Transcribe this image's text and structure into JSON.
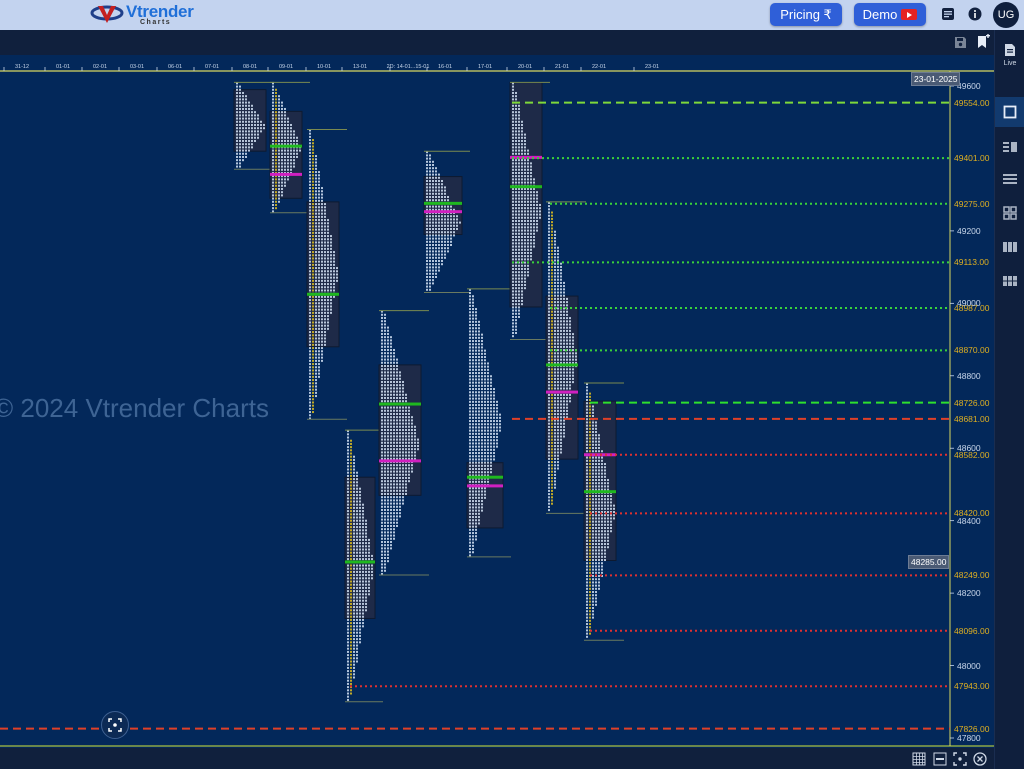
{
  "header": {
    "logo_text": "Vtrender",
    "logo_sub": "Charts",
    "pricing_label": "Pricing ₹",
    "demo_label": "Demo",
    "avatar_initials": "UG"
  },
  "right_sidebar": {
    "live_label": "Live",
    "items": [
      "single-chart",
      "split-chart",
      "rows-layout",
      "grid-layout",
      "columns-layout",
      "table-layout"
    ]
  },
  "watermark": "© 2024 Vtrender Charts",
  "chart": {
    "date_tooltip": "23-01-2025",
    "price_tooltip": "48285.00",
    "x_dates": [
      "31-12",
      "01-01",
      "02-01",
      "03-01",
      "06-01",
      "07-01",
      "08-01",
      "09-01",
      "10-01",
      "13-01",
      "2D: 14-01...15-01",
      "16-01",
      "17-01",
      "20-01",
      "21-01",
      "22-01",
      "23-01"
    ],
    "y_ticks": [
      "49600",
      "49200",
      "49000",
      "48800",
      "48600",
      "48400",
      "48200",
      "48000",
      "47800"
    ],
    "levels": [
      {
        "label": "49554.00",
        "value": 49554,
        "color": "#7fd83a",
        "style": "dashed"
      },
      {
        "label": "49401.00",
        "value": 49401,
        "color": "#39d23a",
        "style": "dotted"
      },
      {
        "label": "49275.00",
        "value": 49275,
        "color": "#39d23a",
        "style": "dotted"
      },
      {
        "label": "49113.00",
        "value": 49113,
        "color": "#39d23a",
        "style": "dotted"
      },
      {
        "label": "48987.00",
        "value": 48987,
        "color": "#39d23a",
        "style": "dotted"
      },
      {
        "label": "48870.00",
        "value": 48870,
        "color": "#39d23a",
        "style": "dotted"
      },
      {
        "label": "48726.00",
        "value": 48726,
        "color": "#2ee02e",
        "style": "dashed"
      },
      {
        "label": "48681.00",
        "value": 48681,
        "color": "#e04028",
        "style": "dashed"
      },
      {
        "label": "48582.00",
        "value": 48582,
        "color": "#e03030",
        "style": "dotted"
      },
      {
        "label": "48420.00",
        "value": 48420,
        "color": "#e03030",
        "style": "dotted"
      },
      {
        "label": "48249.00",
        "value": 48249,
        "color": "#e03030",
        "style": "dotted"
      },
      {
        "label": "48096.00",
        "value": 48096,
        "color": "#e03030",
        "style": "dotted"
      },
      {
        "label": "47943.00",
        "value": 47943,
        "color": "#e03030",
        "style": "dotted"
      },
      {
        "label": "47826.00",
        "value": 47826,
        "color": "#e04028",
        "style": "dashed"
      }
    ],
    "profiles": [
      {
        "date": "08-01",
        "high": 49610,
        "low": 49370,
        "vah": 49590,
        "val": 49420,
        "poc": null,
        "vpoc": null
      },
      {
        "date": "09-01",
        "high": 49610,
        "low": 49250,
        "vah": 49530,
        "val": 49290,
        "poc": 49434,
        "vpoc": 49356
      },
      {
        "date": "10-01",
        "high": 49480,
        "low": 48680,
        "vah": 49280,
        "val": 48880,
        "poc": 49025,
        "vpoc": null
      },
      {
        "date": "13-01",
        "high": 48650,
        "low": 47900,
        "vah": 48520,
        "val": 48130,
        "poc": 48286,
        "vpoc": null
      },
      {
        "date": "2D: 14-01...15-01",
        "high": 48980,
        "low": 48250,
        "vah": 48830,
        "val": 48470,
        "poc": 48722,
        "vpoc": 48565
      },
      {
        "date": "16-01",
        "high": 49420,
        "low": 49030,
        "vah": 49350,
        "val": 49190,
        "poc": 49276,
        "vpoc": 49253
      },
      {
        "date": "17-01",
        "high": 49040,
        "low": 48300,
        "vah": 48560,
        "val": 48380,
        "poc": 48520,
        "vpoc": 48496
      },
      {
        "date": "20-01",
        "high": 49610,
        "low": 48900,
        "vah": 49610,
        "val": 48990,
        "poc": 49322,
        "vpoc": 49403
      },
      {
        "date": "21-01",
        "high": 49280,
        "low": 48420,
        "vah": 49020,
        "val": 48570,
        "poc": 48830,
        "vpoc": 48755
      },
      {
        "date": "22-01",
        "high": 48780,
        "low": 48070,
        "vah": 48730,
        "val": 48290,
        "poc": 48480,
        "vpoc": 48582
      }
    ]
  },
  "bottom_bar": {
    "items": [
      "grid-icon",
      "abc-icon",
      "screenshot-icon",
      "close-icon"
    ]
  }
}
